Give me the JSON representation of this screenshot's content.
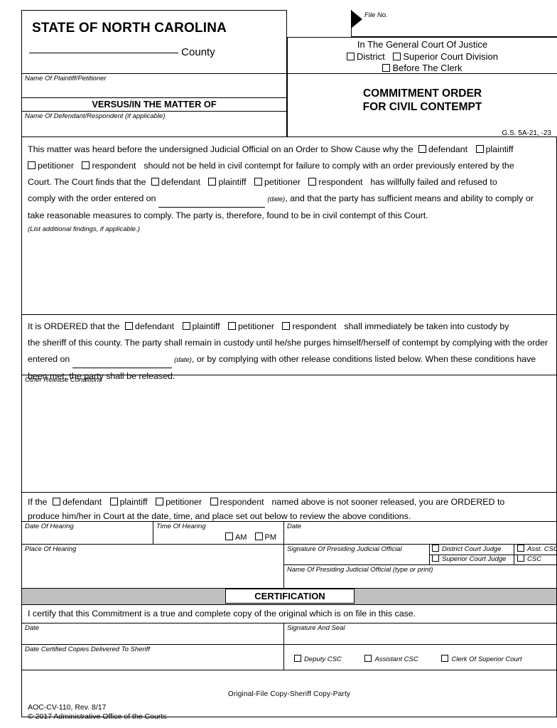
{
  "header": {
    "state_title": "STATE OF NORTH CAROLINA",
    "county_label": "County",
    "file_no_label": "File No.",
    "court_line1": "In The General Court Of Justice",
    "court_district": "District",
    "court_superior": "Superior Court Division",
    "court_before_clerk": "Before The Clerk"
  },
  "caption": {
    "plaintiff_label": "Name Of Plaintiff/Petitioner",
    "versus": "VERSUS/IN THE MATTER OF",
    "defendant_label": "Name Of Defendant/Respondent (if applicable)"
  },
  "title_block": {
    "line1": "COMMITMENT ORDER",
    "line2": "FOR CIVIL CONTEMPT",
    "statute": "G.S. 5A-21, -23"
  },
  "findings": {
    "p1_a": "This matter was heard before the undersigned Judicial Official on an Order to Show Cause why the",
    "cb_defendant": "defendant",
    "cb_plaintiff": "plaintiff",
    "cb_petitioner": "petitioner",
    "cb_respondent": "respondent",
    "p1_b": "should not be held in civil contempt for failure to comply with an order previously entered by the",
    "p1_c": "Court. The Court finds that the",
    "p1_d": "has willfully failed and refused to",
    "p1_e": "comply with the order entered on",
    "date_note": "(date)",
    "p1_f": ", and that the party has sufficient means and ability to comply or",
    "p1_g": "take reasonable measures to comply. The party is, therefore, found to be in civil contempt of this Court.",
    "additional_findings_note": "(List additional findings, if applicable.)"
  },
  "ordered": {
    "a": "It is ORDERED that the",
    "b": "shall immediately be taken into custody by",
    "c": "the sheriff of this county. The party shall remain in custody until he/she purges himself/herself of contempt by complying with the order",
    "d": "entered on",
    "date_note": "(date)",
    "e": ", or by complying with other release conditions listed below.  When these conditions have",
    "f": "been met, the party shall be released."
  },
  "other_release": {
    "label": "Other Release Conditions"
  },
  "if_the": {
    "a": "If the",
    "b": "named above is not sooner released, you are ORDERED to",
    "c": "produce him/her in Court at the date, time, and place set out below to review the above conditions."
  },
  "hearing": {
    "date_of_hearing": "Date Of Hearing",
    "time_of_hearing": "Time Of Hearing",
    "am": "AM",
    "pm": "PM",
    "date": "Date",
    "place_of_hearing": "Place Of Hearing",
    "signature_official": "Signature Of Presiding Judicial Official",
    "name_official": "Name Of Presiding Judicial Official (type or print)",
    "roles": {
      "district_court_judge": "District Court Judge",
      "superior_court_judge": "Superior Court Judge",
      "asst_csc": "Asst. CSC",
      "csc": "CSC"
    }
  },
  "certification": {
    "banner": "CERTIFICATION",
    "statement": "I certify that this Commitment is a true and complete copy of the original which is on file in this case.",
    "date_label": "Date",
    "signature_seal_label": "Signature And Seal",
    "delivered_label": "Date Certified Copies Delivered To Sheriff",
    "roles": {
      "deputy_csc": "Deputy CSC",
      "assistant_csc": "Assistant CSC",
      "clerk_superior": "Clerk Of Superior Court"
    }
  },
  "footer": {
    "copies": "Original-File   Copy-Sheriff   Copy-Party",
    "form_number": "AOC-CV-110, Rev. 8/17",
    "copyright": "© 2017 Administrative Office of the Courts"
  }
}
